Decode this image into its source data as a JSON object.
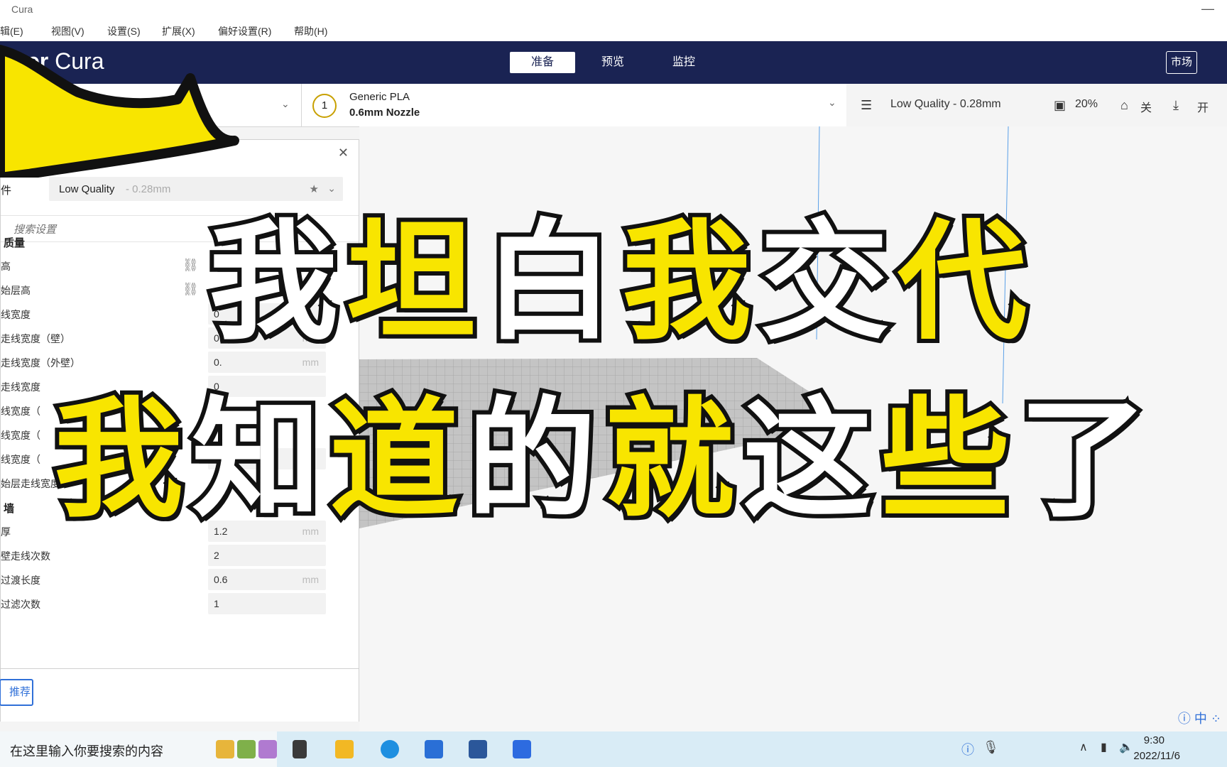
{
  "window": {
    "title": "Cura",
    "controls": "—"
  },
  "menu": [
    "辑(E)",
    "视图(V)",
    "设置(S)",
    "扩展(X)",
    "偏好设置(R)",
    "帮助(H)"
  ],
  "header": {
    "logo_part1": "er",
    "logo_part2": " Cura",
    "tabs": [
      "准备",
      "预览",
      "监控"
    ],
    "market": "市场"
  },
  "toolbar": {
    "extruder": "1",
    "material": "Generic PLA",
    "nozzle": "0.6mm Nozzle",
    "profile": "Low Quality - 0.28mm",
    "infill": "20%",
    "support": "关",
    "adhesion": "开"
  },
  "panel": {
    "profile_label": "件",
    "profile_name": "Low Quality",
    "profile_sub": "- 0.28mm",
    "search_placeholder": "搜索设置",
    "section_quality": "质量",
    "quality_rows": [
      {
        "label": "高",
        "value": "",
        "unit": ""
      },
      {
        "label": "始层高",
        "value": "",
        "unit": ""
      },
      {
        "label": "线宽度",
        "value": "0",
        "unit": ""
      },
      {
        "label": "走线宽度（壁）",
        "value": "0.6",
        "unit": "mm"
      },
      {
        "label": "走线宽度（外壁）",
        "value": "0.",
        "unit": "mm"
      },
      {
        "label": "走线宽度",
        "value": "0",
        "unit": ""
      },
      {
        "label": "线宽度（",
        "value": "",
        "unit": ""
      },
      {
        "label": "线宽度（",
        "value": "",
        "unit": ""
      },
      {
        "label": "线宽度（",
        "value": "0.6",
        "unit": ""
      },
      {
        "label": "始层走线宽度",
        "value": "",
        "unit": ""
      }
    ],
    "section_walls": "墙",
    "wall_rows": [
      {
        "label": "厚",
        "value": "1.2",
        "unit": "mm"
      },
      {
        "label": "壁走线次数",
        "value": "2",
        "unit": ""
      },
      {
        "label": "过渡长度",
        "value": "0.6",
        "unit": "mm"
      },
      {
        "label": "过滤次数",
        "value": "1",
        "unit": ""
      }
    ],
    "recommend": "推荐"
  },
  "caption": {
    "line1": "我坦白我交代",
    "line2": "我知道的就这些了"
  },
  "taskbar": {
    "search": "在这里输入你要搜索的内容",
    "time": "9:30",
    "date": "2022/11/6",
    "ime": "中"
  }
}
